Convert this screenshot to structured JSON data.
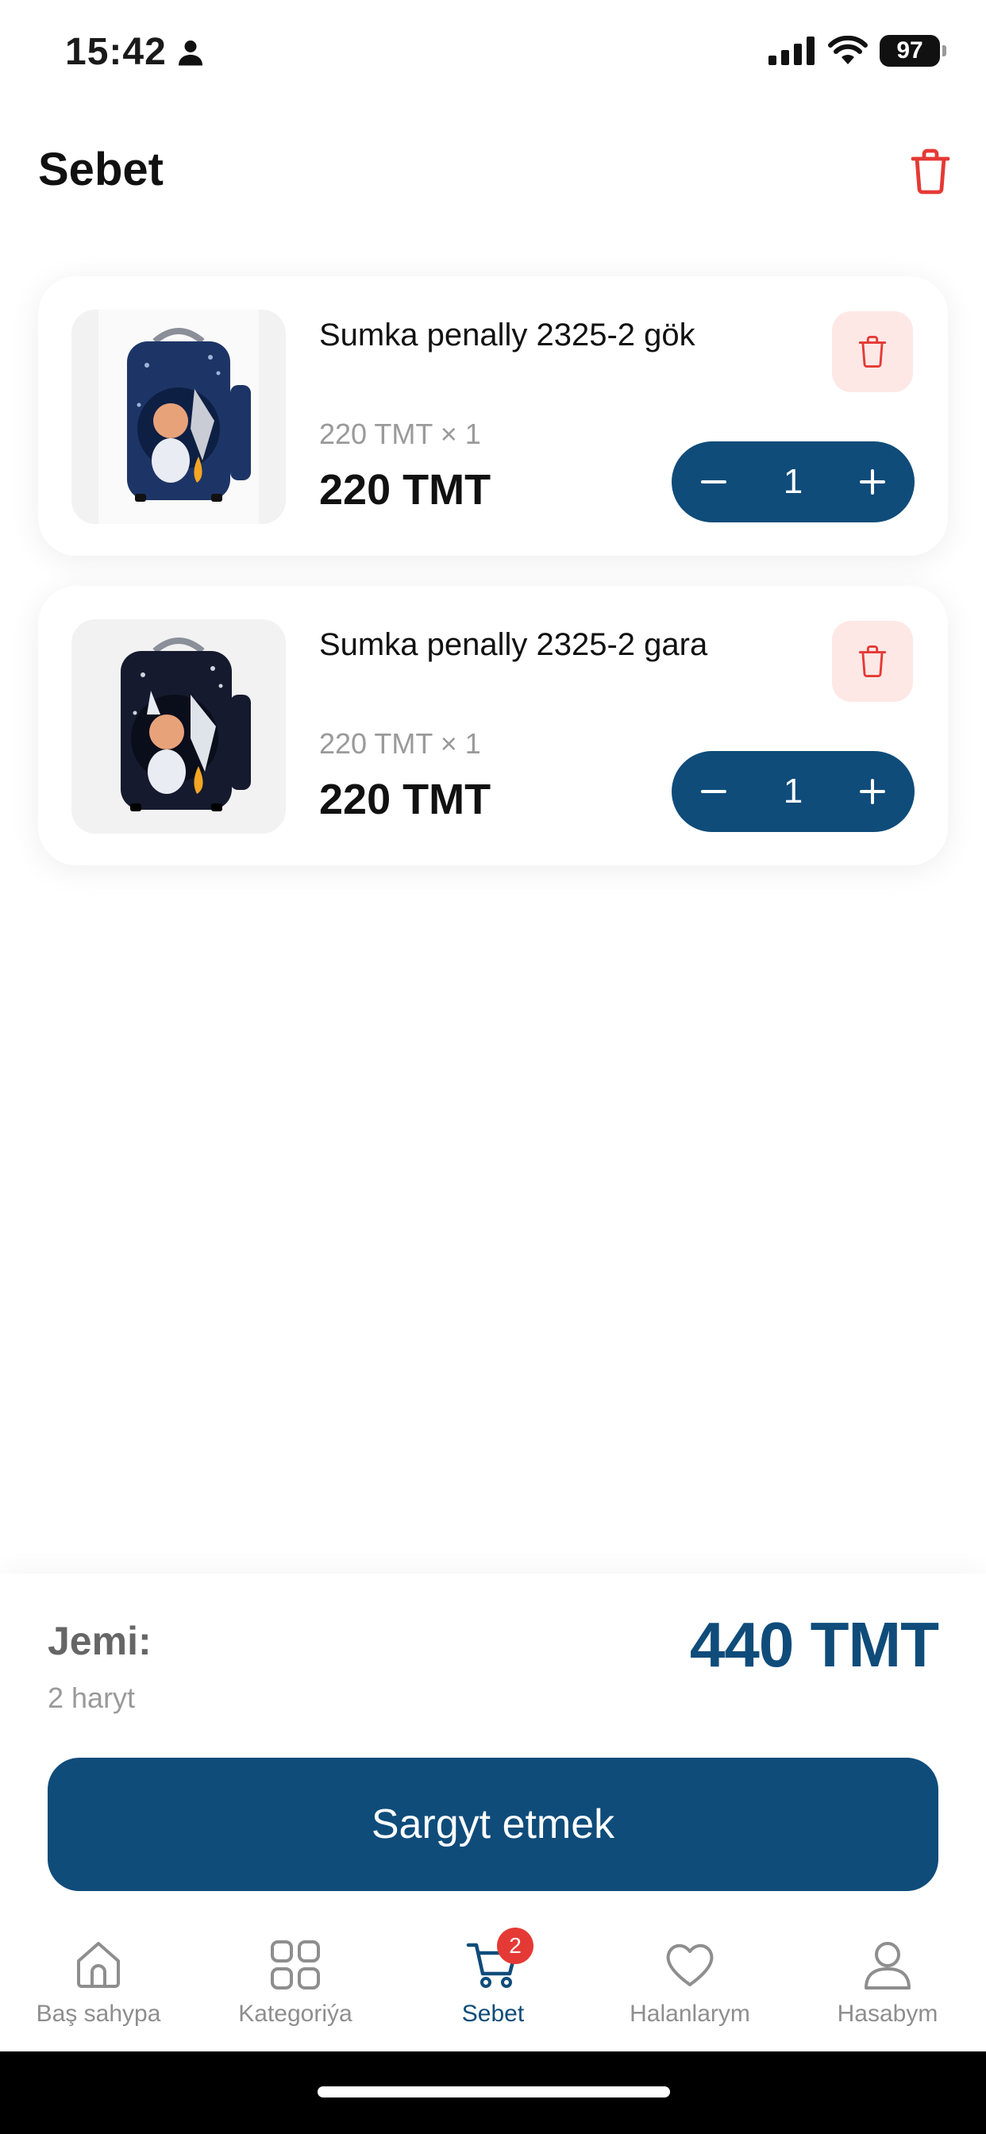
{
  "status_bar": {
    "time": "15:42",
    "battery": "97"
  },
  "header": {
    "title": "Sebet"
  },
  "cart": {
    "items": [
      {
        "name": "Sumka penally 2325-2 gök",
        "unit_price": "220 TMT × 1",
        "total": "220 TMT",
        "quantity": "1"
      },
      {
        "name": "Sumka penally 2325-2 gara",
        "unit_price": "220 TMT × 1",
        "total": "220 TMT",
        "quantity": "1"
      }
    ]
  },
  "summary": {
    "total_label": "Jemi:",
    "count_label": "2 haryt",
    "total_value": "440 TMT",
    "checkout_label": "Sargyt etmek"
  },
  "nav": {
    "items": [
      {
        "label": "Baş sahypa",
        "icon": "home-icon"
      },
      {
        "label": "Kategoriýa",
        "icon": "grid-icon"
      },
      {
        "label": "Sebet",
        "icon": "cart-icon",
        "badge": "2"
      },
      {
        "label": "Halanlarym",
        "icon": "heart-icon"
      },
      {
        "label": "Hasabym",
        "icon": "user-icon"
      }
    ]
  },
  "colors": {
    "primary": "#0f4c7a",
    "danger": "#e53935",
    "danger_bg": "#fde8e6"
  }
}
